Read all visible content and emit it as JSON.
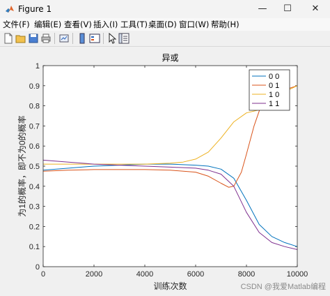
{
  "window": {
    "title": "Figure 1",
    "controls": {
      "minimize": "—",
      "maximize": "☐",
      "close": "✕"
    }
  },
  "menubar": [
    "文件(F)",
    "编辑(E)",
    "查看(V)",
    "插入(I)",
    "工具(T)",
    "桌面(D)",
    "窗口(W)",
    "帮助(H)"
  ],
  "toolbar_icons": [
    "new-figure-icon",
    "open-file-icon",
    "save-icon",
    "print-icon",
    "link-plot-icon",
    "insert-colorbar-icon",
    "insert-legend-icon",
    "edit-plot-icon",
    "property-inspector-icon"
  ],
  "watermark": "CSDN @我爱Matlab编程",
  "chart_data": {
    "type": "line",
    "title": "异或",
    "xlabel": "训练次数",
    "ylabel": "为1的概率，即不为0的概率",
    "xlim": [
      0,
      10000
    ],
    "ylim": [
      0,
      1
    ],
    "xticks": [
      0,
      2000,
      4000,
      6000,
      8000,
      10000
    ],
    "yticks": [
      0,
      0.1,
      0.2,
      0.3,
      0.4,
      0.5,
      0.6,
      0.7,
      0.8,
      0.9,
      1
    ],
    "grid": false,
    "legend": {
      "location": "top-right"
    },
    "series": [
      {
        "name": "0  0",
        "color": "#0072bd",
        "x": [
          0,
          1000,
          2000,
          3000,
          4000,
          5000,
          6000,
          6500,
          7000,
          7500,
          8000,
          8500,
          9000,
          9500,
          10000
        ],
        "y": [
          0.48,
          0.49,
          0.5,
          0.505,
          0.51,
          0.51,
          0.505,
          0.5,
          0.485,
          0.44,
          0.33,
          0.21,
          0.15,
          0.12,
          0.1
        ]
      },
      {
        "name": "0  1",
        "color": "#d95319",
        "x": [
          0,
          1000,
          2000,
          3000,
          4000,
          5000,
          6000,
          6500,
          7000,
          7300,
          7500,
          7800,
          8000,
          8300,
          8600,
          9000,
          9500,
          10000
        ],
        "y": [
          0.475,
          0.48,
          0.483,
          0.483,
          0.483,
          0.48,
          0.47,
          0.45,
          0.415,
          0.395,
          0.4,
          0.47,
          0.56,
          0.7,
          0.81,
          0.86,
          0.88,
          0.9
        ]
      },
      {
        "name": "1  0",
        "color": "#edb120",
        "x": [
          0,
          1000,
          2000,
          3000,
          4000,
          5000,
          5500,
          6000,
          6500,
          7000,
          7500,
          8000,
          8500,
          9000,
          9500,
          10000
        ],
        "y": [
          0.51,
          0.51,
          0.51,
          0.51,
          0.51,
          0.515,
          0.52,
          0.535,
          0.57,
          0.64,
          0.72,
          0.765,
          0.78,
          0.82,
          0.87,
          0.9
        ]
      },
      {
        "name": "1  1",
        "color": "#7e2f8e",
        "x": [
          0,
          1000,
          2000,
          3000,
          4000,
          5000,
          6000,
          6500,
          7000,
          7500,
          8000,
          8500,
          9000,
          9500,
          10000
        ],
        "y": [
          0.53,
          0.52,
          0.51,
          0.505,
          0.5,
          0.495,
          0.49,
          0.48,
          0.46,
          0.4,
          0.27,
          0.17,
          0.12,
          0.1,
          0.085
        ]
      }
    ]
  }
}
